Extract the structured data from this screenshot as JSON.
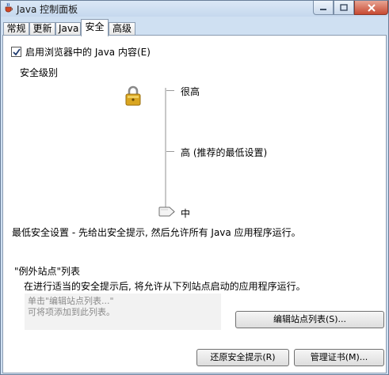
{
  "window": {
    "title": "Java 控制面板"
  },
  "tabs": [
    {
      "label": "常规",
      "active": false
    },
    {
      "label": "更新",
      "active": false
    },
    {
      "label": "Java",
      "active": false
    },
    {
      "label": "安全",
      "active": true
    },
    {
      "label": "高级",
      "active": false
    }
  ],
  "security": {
    "enable_java_checkbox": {
      "label": "启用浏览器中的 Java 内容(E)",
      "checked": true
    },
    "level_section_label": "安全级别",
    "slider": {
      "levels": [
        "很高",
        "高 (推荐的最低设置)",
        "中"
      ],
      "selected": "中"
    },
    "level_description": "最低安全设置 - 先给出安全提示, 然后允许所有 Java 应用程序运行。",
    "exception_sites": {
      "title": "\"例外站点\"列表",
      "description": "在进行适当的安全提示后, 将允许从下列站点启动的应用程序运行。",
      "placeholder_line1": "单击\"编辑站点列表...\"",
      "placeholder_line2": "可将项添加到此列表。",
      "edit_button": "编辑站点列表(S)..."
    },
    "restore_prompts_button": "还原安全提示(R)",
    "manage_certs_button": "管理证书(M)..."
  },
  "colors": {
    "window_frame": "#cfe0f2",
    "close_button": "#c74a32",
    "list_background": "#f2f2f2",
    "lock_gold": "#d9a520"
  },
  "icons": {
    "title": "java-cup-icon",
    "lock": "padlock-icon"
  }
}
